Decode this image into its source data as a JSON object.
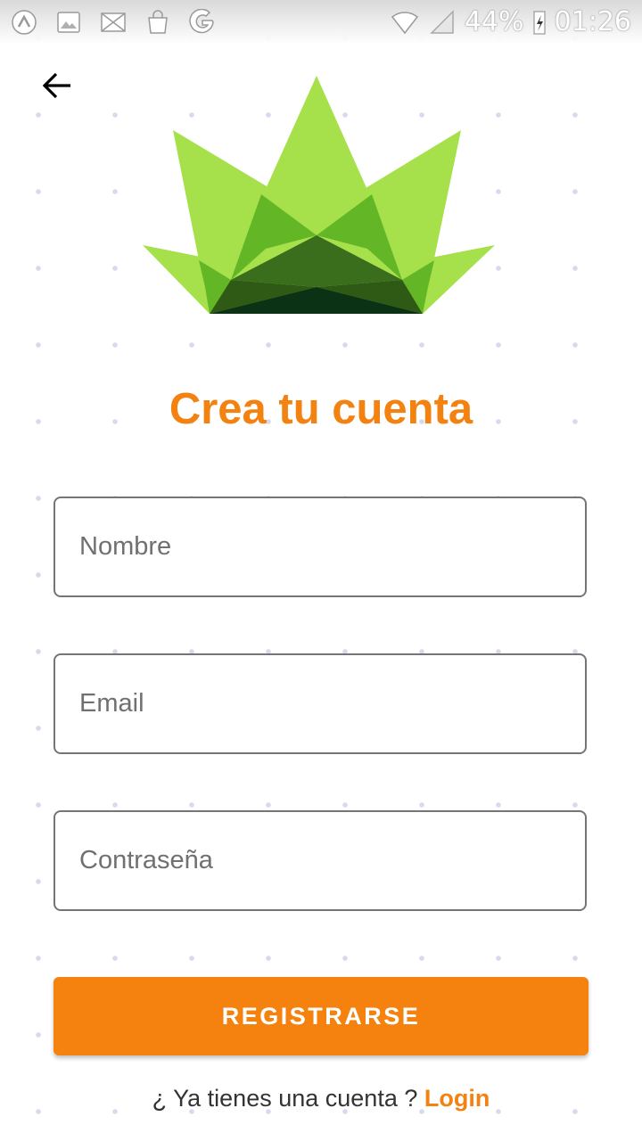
{
  "status_bar": {
    "battery": "44%",
    "time": "01:26"
  },
  "page": {
    "title": "Crea tu cuenta"
  },
  "form": {
    "name_placeholder": "Nombre",
    "email_placeholder": "Email",
    "password_placeholder": "Contraseña",
    "register_label": "REGISTRARSE"
  },
  "footer": {
    "question": "¿ Ya tienes una cuenta ?",
    "login_label": "Login"
  },
  "colors": {
    "accent": "#f38211",
    "logo_light_green": "#a6e04a",
    "logo_dark_green": "#0c3216"
  },
  "icons": {
    "back": "arrow-left-icon",
    "status_left": [
      "launcher-icon",
      "image-icon",
      "mail-icon",
      "shopping-bag-icon",
      "google-icon"
    ],
    "status_right": [
      "wifi-icon",
      "signal-icon",
      "battery-charging-icon"
    ]
  }
}
